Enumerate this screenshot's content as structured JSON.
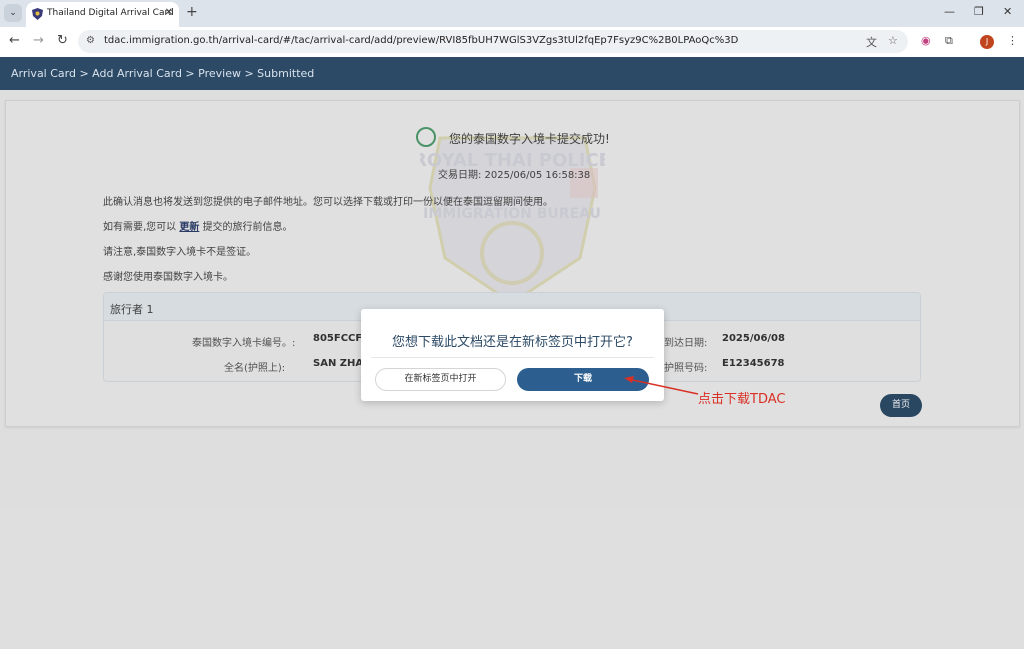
{
  "browser": {
    "tab_title": "Thailand Digital Arrival Card",
    "url": "tdac.immigration.go.th/arrival-card/#/tac/arrival-card/add/preview/RVI85fbUH7WGlS3VZgs3tUl2fqEp7Fsyz9C%2B0LPAoQc%3D",
    "profile_initial": "J"
  },
  "page": {
    "breadcrumb": "Arrival Card > Add Arrival Card > Preview > Submitted",
    "success_message": "您的泰国数字入境卡提交成功!",
    "transaction_date": "交易日期: 2025/06/05 16:58:38",
    "info_line_1": "此确认消息也将发送到您提供的电子邮件地址。您可以选择下载或打印一份以便在泰国逗留期间使用。",
    "info_line_2_prefix": "如有需要,您可以",
    "info_line_2_link": "更新",
    "info_line_2_suffix": "提交的旅行前信息。",
    "info_line_3": "请注意,泰国数字入境卡不是签证。",
    "info_line_4": "感谢您使用泰国数字入境卡。",
    "watermark_text_top": "ROYAL THAI POLICE",
    "watermark_text_mid": "IMMIGRATION BUREAU"
  },
  "traveler": {
    "title": "旅行者 1",
    "card_no_label": "泰国数字入境卡编号。:",
    "card_no_value": "805FCCF",
    "name_label": "全名(护照上):",
    "name_value": "SAN ZHAN",
    "arrival_label": "到达日期:",
    "arrival_value": "2025/06/08",
    "passport_label": "护照号码:",
    "passport_value": "E12345678"
  },
  "home_button": "首页",
  "modal": {
    "title": "您想下载此文档还是在新标签页中打开它?",
    "open_new_tab": "在新标签页中打开",
    "download": "下载"
  },
  "annotation": "点击下载TDAC"
}
